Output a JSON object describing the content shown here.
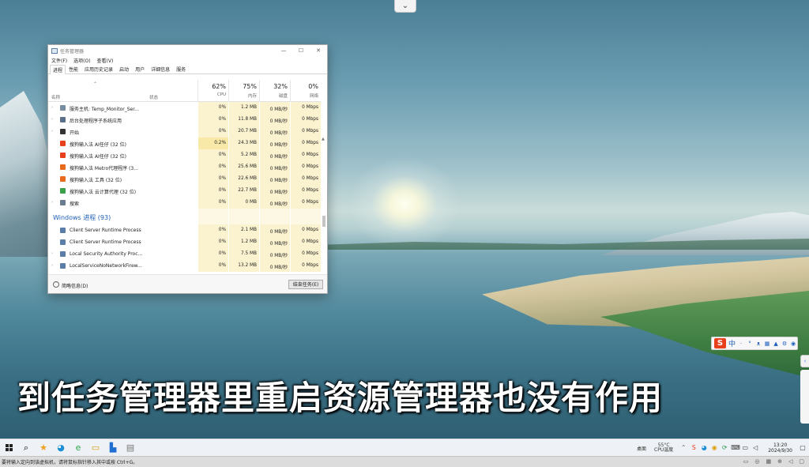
{
  "top_handle": {
    "icon": "chevron-down-icon",
    "glyph": "⌄"
  },
  "task_manager": {
    "title": "任务管理器",
    "window_buttons": {
      "minimize": "—",
      "maximize": "☐",
      "close": "✕"
    },
    "menu": [
      "文件(F)",
      "选项(O)",
      "查看(V)"
    ],
    "tabs": [
      "进程",
      "性能",
      "应用历史记录",
      "启动",
      "用户",
      "详细信息",
      "服务"
    ],
    "active_tab": "进程",
    "columns": {
      "name": "名称",
      "status": "状态",
      "metrics": [
        {
          "pct": "62%",
          "label": "CPU"
        },
        {
          "pct": "75%",
          "label": "内存"
        },
        {
          "pct": "32%",
          "label": "磁盘"
        },
        {
          "pct": "0%",
          "label": "网络"
        }
      ]
    },
    "rows": [
      {
        "expand": "›",
        "icon_color": "#7a8da0",
        "name": "服务主机: Temp_Monitor_Ser...",
        "cpu": "0%",
        "mem": "1.2 MB",
        "disk": "0 MB/秒",
        "net": "0 Mbps"
      },
      {
        "expand": "›",
        "icon_color": "#5b6e8a",
        "name": "后台处理程序子系统应用",
        "cpu": "0%",
        "mem": "11.8 MB",
        "disk": "0 MB/秒",
        "net": "0 Mbps"
      },
      {
        "expand": "›",
        "icon_color": "#333333",
        "name": "开始",
        "cpu": "0%",
        "mem": "20.7 MB",
        "disk": "0 MB/秒",
        "net": "0 Mbps"
      },
      {
        "expand": "",
        "icon_color": "#e8401c",
        "name": "搜狗输入法 AI任仔 (32 位)",
        "cpu": "0.2%",
        "mem": "24.3 MB",
        "disk": "0 MB/秒",
        "net": "0 Mbps"
      },
      {
        "expand": "",
        "icon_color": "#e8401c",
        "name": "搜狗输入法 AI任仔 (32 位)",
        "cpu": "0%",
        "mem": "5.2 MB",
        "disk": "0 MB/秒",
        "net": "0 Mbps"
      },
      {
        "expand": "",
        "icon_color": "#e86a1c",
        "name": "搜狗输入法 Metro代理程序 (3...",
        "cpu": "0%",
        "mem": "25.6 MB",
        "disk": "0 MB/秒",
        "net": "0 Mbps"
      },
      {
        "expand": "",
        "icon_color": "#e86a1c",
        "name": "搜狗输入法 工具 (32 位)",
        "cpu": "0%",
        "mem": "22.6 MB",
        "disk": "0 MB/秒",
        "net": "0 Mbps"
      },
      {
        "expand": "",
        "icon_color": "#3aa14a",
        "name": "搜狗输入法 云计算代理 (32 位)",
        "cpu": "0%",
        "mem": "22.7 MB",
        "disk": "0 MB/秒",
        "net": "0 Mbps"
      },
      {
        "expand": "›",
        "icon_color": "#6b7c8e",
        "name": "搜索",
        "cpu": "0%",
        "mem": "0 MB",
        "disk": "0 MB/秒",
        "net": "0 Mbps"
      }
    ],
    "group_label": "Windows 进程 (93)",
    "group_rows": [
      {
        "expand": "",
        "icon_color": "#5a7ea8",
        "name": "Client Server Runtime Process",
        "cpu": "0%",
        "mem": "2.1 MB",
        "disk": "0 MB/秒",
        "net": "0 Mbps"
      },
      {
        "expand": "",
        "icon_color": "#5a7ea8",
        "name": "Client Server Runtime Process",
        "cpu": "0%",
        "mem": "1.2 MB",
        "disk": "0 MB/秒",
        "net": "0 Mbps"
      },
      {
        "expand": "›",
        "icon_color": "#5a7ea8",
        "name": "Local Security Authority Proc...",
        "cpu": "0%",
        "mem": "7.5 MB",
        "disk": "0 MB/秒",
        "net": "0 Mbps"
      },
      {
        "expand": "›",
        "icon_color": "#5a7ea8",
        "name": "LocalServiceNoNetworkFirew...",
        "cpu": "0%",
        "mem": "13.2 MB",
        "disk": "0 MB/秒",
        "net": "0 Mbps"
      }
    ],
    "footer": {
      "less_details": "简略信息(D)",
      "end_task": "结束任务(E)"
    }
  },
  "ime_toolbar": {
    "logo": "S",
    "mode": "中",
    "icons": [
      "·",
      "°",
      "ᴥ",
      "▦",
      "▲",
      "⚙",
      "◉"
    ]
  },
  "caption": "到任务管理器里重启资源管理器也没有作用",
  "taskbar": {
    "icons": [
      {
        "name": "search-icon",
        "glyph": "⌕"
      },
      {
        "name": "app-star-icon",
        "glyph": "★"
      },
      {
        "name": "qq-icon",
        "glyph": "◕"
      },
      {
        "name": "edge-icon",
        "glyph": "e"
      },
      {
        "name": "file-explorer-icon",
        "glyph": "▭"
      },
      {
        "name": "app-blue-icon",
        "glyph": "▙"
      },
      {
        "name": "app-window-icon",
        "glyph": "▤"
      }
    ],
    "language": "桌面",
    "temperature": "55°C",
    "temp_label": "CPU温度",
    "time": "13:20",
    "date": "2024/9/30"
  },
  "status_strip": {
    "message": "要将输入定向到该虚拟机，请将鼠标指针移入其中或按 Ctrl+G。"
  },
  "colors": {
    "accent_blue": "#1c5fb5",
    "cell_yellow": "#fbf3d0",
    "sogou_red": "#e8401c"
  }
}
